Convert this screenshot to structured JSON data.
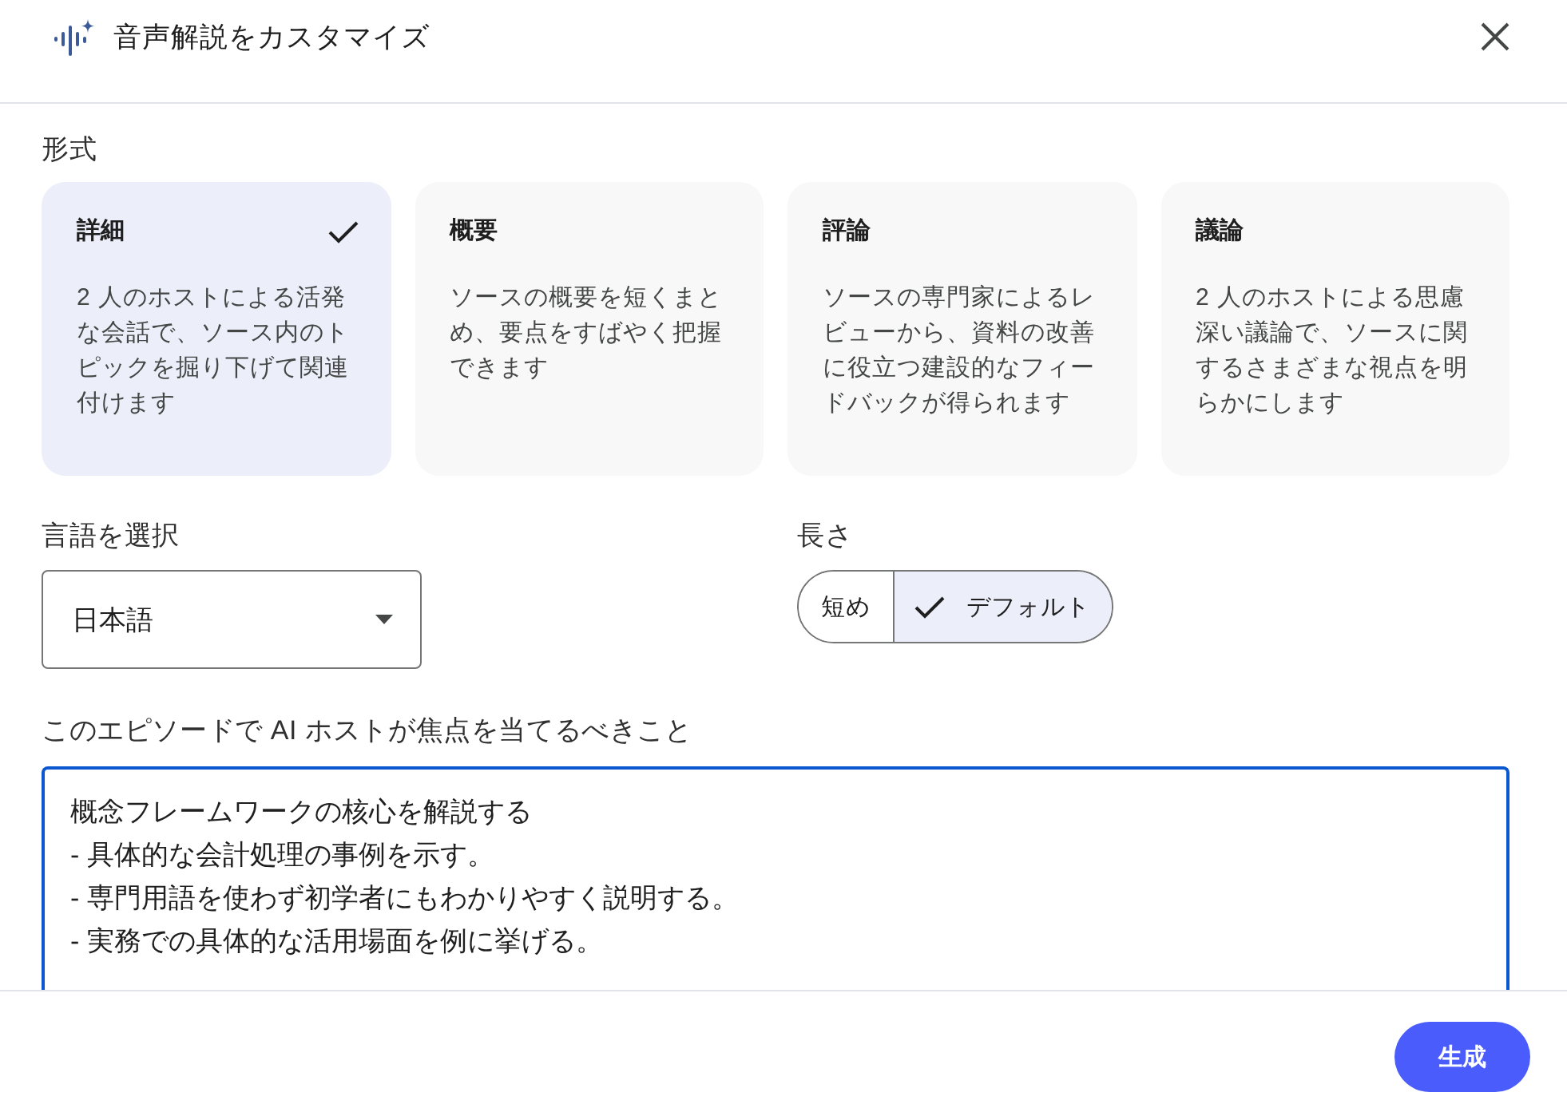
{
  "dialog": {
    "title": "音声解説をカスタマイズ"
  },
  "format": {
    "label": "形式",
    "options": [
      {
        "title": "詳細",
        "description": "2 人のホストによる活発な会話で、ソース内のトピックを掘り下げて関連付けます",
        "selected": true
      },
      {
        "title": "概要",
        "description": "ソースの概要を短くまとめ、要点をすばやく把握できます",
        "selected": false
      },
      {
        "title": "評論",
        "description": "ソースの専門家によるレビューから、資料の改善に役立つ建設的なフィードバックが得られます",
        "selected": false
      },
      {
        "title": "議論",
        "description": "2 人のホストによる思慮深い議論で、ソースに関するさまざまな視点を明らかにします",
        "selected": false
      }
    ]
  },
  "language": {
    "label": "言語を選択",
    "value": "日本語"
  },
  "length": {
    "label": "長さ",
    "options": [
      {
        "label": "短め",
        "selected": false
      },
      {
        "label": "デフォルト",
        "selected": true
      }
    ]
  },
  "focus": {
    "label": "このエピソードで AI ホストが焦点を当てるべきこと",
    "value": "概念フレームワークの核心を解説する\n- 具体的な会計処理の事例を示す。\n- 専門用語を使わず初学者にもわかりやすく説明する。\n- 実務での具体的な活用場面を例に挙げる。"
  },
  "footer": {
    "button": "生成"
  }
}
